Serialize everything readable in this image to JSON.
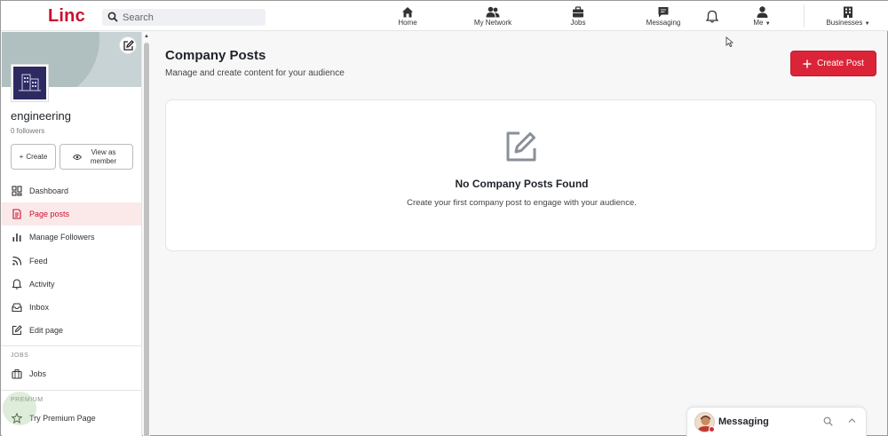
{
  "brand": {
    "logo": "Linc",
    "accent": "#c8102e"
  },
  "search": {
    "placeholder": "Search"
  },
  "nav": {
    "home": "Home",
    "network": "My Network",
    "jobs": "Jobs",
    "messaging": "Messaging",
    "me": "Me",
    "businesses": "Businesses"
  },
  "sidebar": {
    "org_name": "engineering",
    "followers": "0 followers",
    "create_label": "Create",
    "view_label": "View as member",
    "items": [
      {
        "label": "Dashboard",
        "icon": "dashboard-icon"
      },
      {
        "label": "Page posts",
        "icon": "document-icon",
        "active": true
      },
      {
        "label": "Manage Followers",
        "icon": "bar-chart-icon"
      },
      {
        "label": "Feed",
        "icon": "rss-icon"
      },
      {
        "label": "Activity",
        "icon": "bell-icon"
      },
      {
        "label": "Inbox",
        "icon": "inbox-icon"
      },
      {
        "label": "Edit page",
        "icon": "edit-icon"
      }
    ],
    "jobs_section": "JOBS",
    "jobs_item": "Jobs",
    "premium_section": "PREMIUM",
    "premium_item": "Try Premium Page"
  },
  "main": {
    "title": "Company Posts",
    "subtitle": "Manage and create content for your audience",
    "create_post_label": "Create Post",
    "empty_title": "No Company Posts Found",
    "empty_subtitle": "Create your first company post to engage with your audience."
  },
  "messaging_bar": {
    "label": "Messaging"
  }
}
